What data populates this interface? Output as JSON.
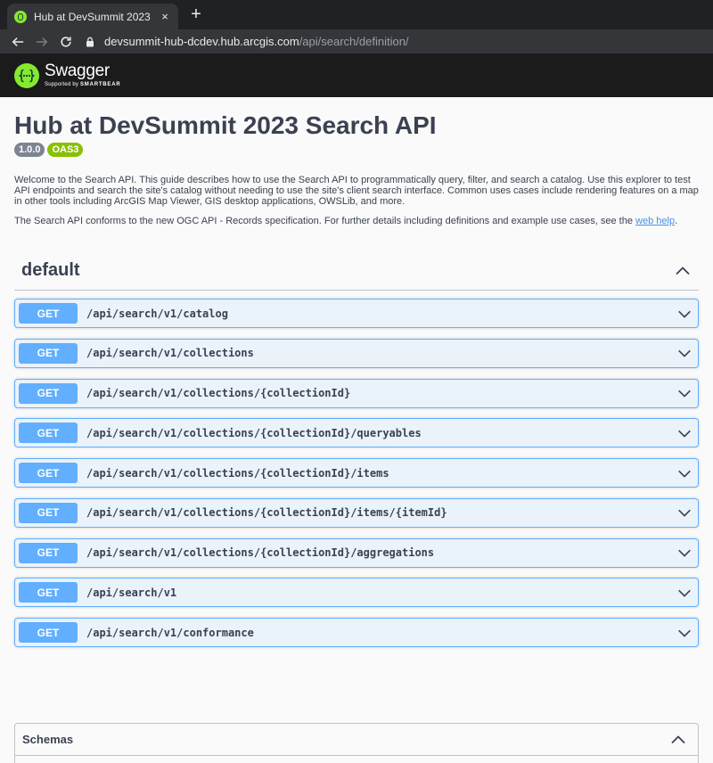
{
  "browser": {
    "tab_title": "Hub at DevSummit 2023 Search API",
    "tab_close": "×",
    "new_tab": "+",
    "url_host": "devsummit-hub-dcdev.hub.arcgis.com",
    "url_path": "/api/search/definition/"
  },
  "swagger": {
    "logo_text": "Swagger",
    "logo_supported": "Supported by",
    "logo_company": "SMARTBEAR"
  },
  "info": {
    "title": "Hub at DevSummit 2023 Search API",
    "version": "1.0.0",
    "oas": "OAS3",
    "description_1": "Welcome to the Search API. This guide describes how to use the Search API to programmatically query, filter, and search a catalog. Use this explorer to test API endpoints and search the site's catalog without needing to use the site's client search interface. Common uses cases include rendering features on a map in other tools including ArcGIS Map Viewer, GIS desktop applications, OWSLib, and more.",
    "description_2": "The Search API conforms to the new OGC API - Records specification. For further details including definitions and example use cases, see the",
    "web_help_link": "web help",
    "period": "."
  },
  "tag": {
    "name": "default"
  },
  "operations": [
    {
      "method": "GET",
      "path": "/api/search/v1/catalog"
    },
    {
      "method": "GET",
      "path": "/api/search/v1/collections"
    },
    {
      "method": "GET",
      "path": "/api/search/v1/collections/{collectionId}"
    },
    {
      "method": "GET",
      "path": "/api/search/v1/collections/{collectionId}/queryables"
    },
    {
      "method": "GET",
      "path": "/api/search/v1/collections/{collectionId}/items"
    },
    {
      "method": "GET",
      "path": "/api/search/v1/collections/{collectionId}/items/{itemId}"
    },
    {
      "method": "GET",
      "path": "/api/search/v1/collections/{collectionId}/aggregations"
    },
    {
      "method": "GET",
      "path": "/api/search/v1"
    },
    {
      "method": "GET",
      "path": "/api/search/v1/conformance"
    }
  ],
  "schemas": {
    "title": "Schemas"
  },
  "colors": {
    "get_method": "#61affe",
    "oas_badge": "#89bf04",
    "version_badge": "#7d8492",
    "swagger_green": "#85ea2d"
  }
}
